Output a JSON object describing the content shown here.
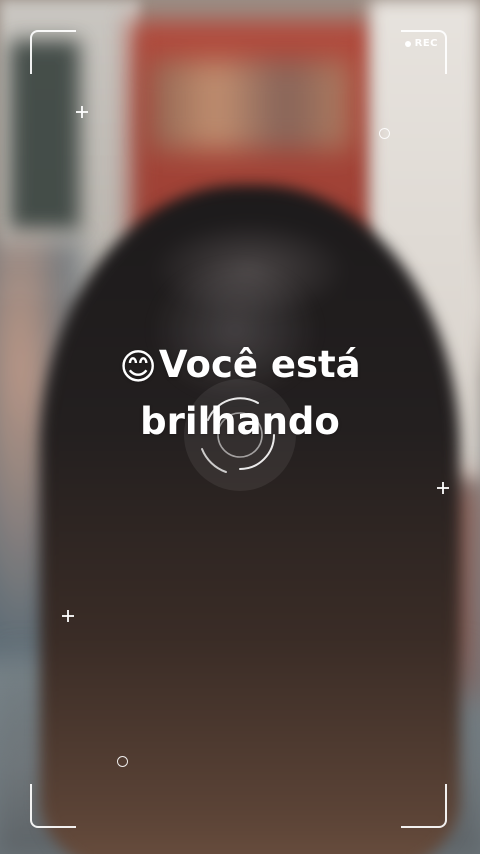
{
  "camera": {
    "rec_label": "REC",
    "caption_line1": "Você está",
    "caption_line2": "brilhando",
    "caption_emoji": "😊"
  },
  "icons": {
    "frame": "viewfinder-corner-icon",
    "focus": "focus-reticle-icon",
    "markers": [
      "plus-marker-icon",
      "circle-marker-icon"
    ]
  },
  "colors": {
    "overlay": "#ffffff",
    "hair": "#1f1c1c"
  }
}
